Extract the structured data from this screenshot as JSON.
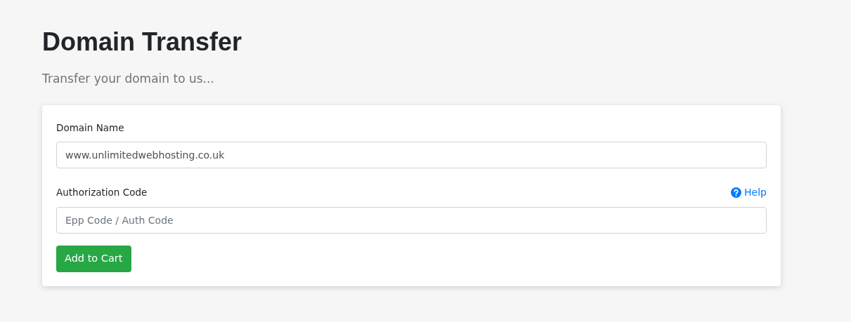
{
  "header": {
    "title": "Domain Transfer",
    "subtitle": "Transfer your domain to us..."
  },
  "form": {
    "domain_field": {
      "label": "Domain Name",
      "value": "www.unlimitedwebhosting.co.uk"
    },
    "auth_field": {
      "label": "Authorization Code",
      "help_link": "Help",
      "placeholder": "Epp Code / Auth Code"
    },
    "submit_button": "Add to Cart"
  }
}
